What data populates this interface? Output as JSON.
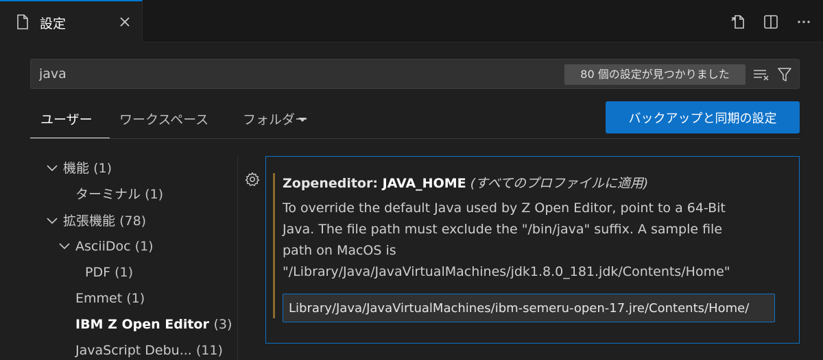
{
  "tab": {
    "label": "設定"
  },
  "search": {
    "value": "java",
    "result_count": "80 個の設定が見つかりました"
  },
  "scopes": {
    "user": "ユーザー",
    "workspace": "ワークスペース",
    "folder": "フォルダー"
  },
  "sync_button": "バックアップと同期の設定",
  "toc": [
    {
      "label": "機能",
      "count": "(1)"
    },
    {
      "label": "ターミナル",
      "count": "(1)"
    },
    {
      "label": "拡張機能",
      "count": "(78)"
    },
    {
      "label": "AsciiDoc",
      "count": "(1)"
    },
    {
      "label": "PDF",
      "count": "(1)"
    },
    {
      "label": "Emmet",
      "count": "(1)"
    },
    {
      "label": "IBM Z Open Editor",
      "count": "(3)"
    },
    {
      "label": "JavaScript Debu...",
      "count": "(11)"
    }
  ],
  "setting": {
    "category": "Zopeneditor: ",
    "key": "JAVA_HOME",
    "scope_note": "(すべてのプロファイルに適用)",
    "description_lines": [
      "To override the default Java used by Z Open Editor, point to a 64-Bit",
      "Java. The file path must exclude the \"/bin/java\" suffix. A sample file",
      "path on MacOS is",
      "\"/Library/Java/JavaVirtualMachines/jdk1.8.0_181.jdk/Contents/Home\""
    ],
    "value": "/Library/Java/JavaVirtualMachines/ibm-semeru-open-17.jre/Contents/Home"
  },
  "colors": {
    "accent": "#0e72c9",
    "modified_indicator": "#8b6a2b",
    "background": "#1f1f1f"
  }
}
